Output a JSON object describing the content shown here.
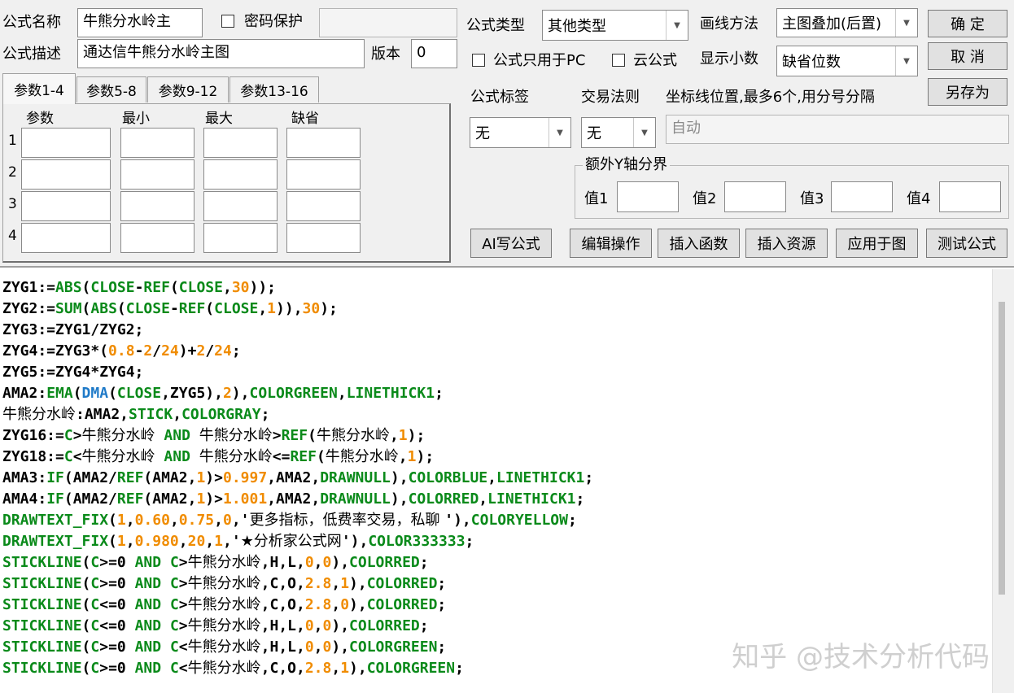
{
  "top": {
    "name_label": "公式名称",
    "name_value": "牛熊分水岭主",
    "password_label": "密码保护",
    "desc_label": "公式描述",
    "desc_value": "通达信牛熊分水岭主图",
    "version_label": "版本",
    "version_value": "0",
    "type_label": "公式类型",
    "type_value": "其他类型",
    "draw_label": "画线方法",
    "draw_value": "主图叠加(后置)",
    "pc_only_label": "公式只用于PC",
    "cloud_label": "云公式",
    "decimal_label": "显示小数",
    "decimal_value": "缺省位数",
    "ok_label": "确 定",
    "cancel_label": "取 消",
    "saveas_label": "另存为"
  },
  "params": {
    "tabs": [
      "参数1-4",
      "参数5-8",
      "参数9-12",
      "参数13-16"
    ],
    "headers": [
      "参数",
      "最小",
      "最大",
      "缺省"
    ],
    "rows": [
      "1",
      "2",
      "3",
      "4"
    ]
  },
  "right": {
    "tag_label": "公式标签",
    "tag_value": "无",
    "rule_label": "交易法则",
    "rule_value": "无",
    "axis_label": "坐标线位置,最多6个,用分号分隔",
    "axis_value": "自动",
    "yaxis_group": "额外Y轴分界",
    "y_labels": [
      "值1",
      "值2",
      "值3",
      "值4"
    ]
  },
  "actions": {
    "ai_label": "AI写公式",
    "edit_label": "编辑操作",
    "insert_func_label": "插入函数",
    "insert_res_label": "插入资源",
    "apply_label": "应用于图",
    "test_label": "测试公式"
  },
  "code_lines": [
    [
      [
        "t",
        "ZYG1:="
      ],
      [
        "k",
        "ABS"
      ],
      [
        "t",
        "("
      ],
      [
        "k",
        "CLOSE"
      ],
      [
        "t",
        "-"
      ],
      [
        "k",
        "REF"
      ],
      [
        "t",
        "("
      ],
      [
        "k",
        "CLOSE"
      ],
      [
        "t",
        ","
      ],
      [
        "n",
        "30"
      ],
      [
        "t",
        "));"
      ]
    ],
    [
      [
        "t",
        "ZYG2:="
      ],
      [
        "k",
        "SUM"
      ],
      [
        "t",
        "("
      ],
      [
        "k",
        "ABS"
      ],
      [
        "t",
        "("
      ],
      [
        "k",
        "CLOSE"
      ],
      [
        "t",
        "-"
      ],
      [
        "k",
        "REF"
      ],
      [
        "t",
        "("
      ],
      [
        "k",
        "CLOSE"
      ],
      [
        "t",
        ","
      ],
      [
        "n",
        "1"
      ],
      [
        "t",
        ")),"
      ],
      [
        "n",
        "30"
      ],
      [
        "t",
        ");"
      ]
    ],
    [
      [
        "t",
        "ZYG3:=ZYG1/ZYG2;"
      ]
    ],
    [
      [
        "t",
        "ZYG4:=ZYG3*("
      ],
      [
        "n",
        "0.8"
      ],
      [
        "t",
        "-"
      ],
      [
        "n",
        "2"
      ],
      [
        "t",
        "/"
      ],
      [
        "n",
        "24"
      ],
      [
        "t",
        ")+"
      ],
      [
        "n",
        "2"
      ],
      [
        "t",
        "/"
      ],
      [
        "n",
        "24"
      ],
      [
        "t",
        ";"
      ]
    ],
    [
      [
        "t",
        "ZYG5:=ZYG4*ZYG4;"
      ]
    ],
    [
      [
        "t",
        "AMA2:"
      ],
      [
        "k",
        "EMA"
      ],
      [
        "t",
        "("
      ],
      [
        "b",
        "DMA"
      ],
      [
        "t",
        "("
      ],
      [
        "k",
        "CLOSE"
      ],
      [
        "t",
        ",ZYG5),"
      ],
      [
        "n",
        "2"
      ],
      [
        "t",
        "),"
      ],
      [
        "k",
        "COLORGREEN"
      ],
      [
        "t",
        ","
      ],
      [
        "k",
        "LINETHICK1"
      ],
      [
        "t",
        ";"
      ]
    ],
    [
      [
        "c",
        "牛熊分水岭"
      ],
      [
        "t",
        ":AMA2,"
      ],
      [
        "k",
        "STICK"
      ],
      [
        "t",
        ","
      ],
      [
        "k",
        "COLORGRAY"
      ],
      [
        "t",
        ";"
      ]
    ],
    [
      [
        "t",
        "ZYG16:="
      ],
      [
        "k",
        "C"
      ],
      [
        "t",
        ">"
      ],
      [
        "c",
        "牛熊分水岭"
      ],
      [
        "t",
        " "
      ],
      [
        "k",
        "AND"
      ],
      [
        "t",
        " "
      ],
      [
        "c",
        "牛熊分水岭"
      ],
      [
        "t",
        ">"
      ],
      [
        "k",
        "REF"
      ],
      [
        "t",
        "("
      ],
      [
        "c",
        "牛熊分水岭"
      ],
      [
        "t",
        ","
      ],
      [
        "n",
        "1"
      ],
      [
        "t",
        ");"
      ]
    ],
    [
      [
        "t",
        "ZYG18:="
      ],
      [
        "k",
        "C"
      ],
      [
        "t",
        "<"
      ],
      [
        "c",
        "牛熊分水岭"
      ],
      [
        "t",
        " "
      ],
      [
        "k",
        "AND"
      ],
      [
        "t",
        " "
      ],
      [
        "c",
        "牛熊分水岭"
      ],
      [
        "t",
        "<="
      ],
      [
        "k",
        "REF"
      ],
      [
        "t",
        "("
      ],
      [
        "c",
        "牛熊分水岭"
      ],
      [
        "t",
        ","
      ],
      [
        "n",
        "1"
      ],
      [
        "t",
        ");"
      ]
    ],
    [
      [
        "t",
        "AMA3:"
      ],
      [
        "k",
        "IF"
      ],
      [
        "t",
        "(AMA2/"
      ],
      [
        "k",
        "REF"
      ],
      [
        "t",
        "(AMA2,"
      ],
      [
        "n",
        "1"
      ],
      [
        "t",
        ")>"
      ],
      [
        "n",
        "0.997"
      ],
      [
        "t",
        ",AMA2,"
      ],
      [
        "k",
        "DRAWNULL"
      ],
      [
        "t",
        "),"
      ],
      [
        "k",
        "COLORBLUE"
      ],
      [
        "t",
        ","
      ],
      [
        "k",
        "LINETHICK1"
      ],
      [
        "t",
        ";"
      ]
    ],
    [
      [
        "t",
        "AMA4:"
      ],
      [
        "k",
        "IF"
      ],
      [
        "t",
        "(AMA2/"
      ],
      [
        "k",
        "REF"
      ],
      [
        "t",
        "(AMA2,"
      ],
      [
        "n",
        "1"
      ],
      [
        "t",
        ")>"
      ],
      [
        "n",
        "1.001"
      ],
      [
        "t",
        ",AMA2,"
      ],
      [
        "k",
        "DRAWNULL"
      ],
      [
        "t",
        "),"
      ],
      [
        "k",
        "COLORRED"
      ],
      [
        "t",
        ","
      ],
      [
        "k",
        "LINETHICK1"
      ],
      [
        "t",
        ";"
      ]
    ],
    [
      [
        "k",
        "DRAWTEXT_FIX"
      ],
      [
        "t",
        "("
      ],
      [
        "n",
        "1"
      ],
      [
        "t",
        ","
      ],
      [
        "n",
        "0.60"
      ],
      [
        "t",
        ","
      ],
      [
        "n",
        "0.75"
      ],
      [
        "t",
        ","
      ],
      [
        "n",
        "0"
      ],
      [
        "t",
        ",'"
      ],
      [
        "c",
        "更多指标，低费率交易，私聊 "
      ],
      [
        "t",
        "'),"
      ],
      [
        "k",
        "COLORYELLOW"
      ],
      [
        "t",
        ";"
      ]
    ],
    [
      [
        "k",
        "DRAWTEXT_FIX"
      ],
      [
        "t",
        "("
      ],
      [
        "n",
        "1"
      ],
      [
        "t",
        ","
      ],
      [
        "n",
        "0.980"
      ],
      [
        "t",
        ","
      ],
      [
        "n",
        "20"
      ],
      [
        "t",
        ","
      ],
      [
        "n",
        "1"
      ],
      [
        "t",
        ",'"
      ],
      [
        "c",
        "★分析家公式网"
      ],
      [
        "t",
        "'),"
      ],
      [
        "k",
        "COLOR333333"
      ],
      [
        "t",
        ";"
      ]
    ],
    [
      [
        "k",
        "STICKLINE"
      ],
      [
        "t",
        "("
      ],
      [
        "k",
        "C"
      ],
      [
        "t",
        ">=0 "
      ],
      [
        "k",
        "AND"
      ],
      [
        "t",
        " "
      ],
      [
        "k",
        "C"
      ],
      [
        "t",
        ">"
      ],
      [
        "c",
        "牛熊分水岭"
      ],
      [
        "t",
        ",H,L,"
      ],
      [
        "n",
        "0"
      ],
      [
        "t",
        ","
      ],
      [
        "n",
        "0"
      ],
      [
        "t",
        "),"
      ],
      [
        "k",
        "COLORRED"
      ],
      [
        "t",
        ";"
      ]
    ],
    [
      [
        "k",
        "STICKLINE"
      ],
      [
        "t",
        "("
      ],
      [
        "k",
        "C"
      ],
      [
        "t",
        ">=0 "
      ],
      [
        "k",
        "AND"
      ],
      [
        "t",
        " "
      ],
      [
        "k",
        "C"
      ],
      [
        "t",
        ">"
      ],
      [
        "c",
        "牛熊分水岭"
      ],
      [
        "t",
        ",C,O,"
      ],
      [
        "n",
        "2.8"
      ],
      [
        "t",
        ","
      ],
      [
        "n",
        "1"
      ],
      [
        "t",
        "),"
      ],
      [
        "k",
        "COLORRED"
      ],
      [
        "t",
        ";"
      ]
    ],
    [
      [
        "k",
        "STICKLINE"
      ],
      [
        "t",
        "("
      ],
      [
        "k",
        "C"
      ],
      [
        "t",
        "<=0 "
      ],
      [
        "k",
        "AND"
      ],
      [
        "t",
        " "
      ],
      [
        "k",
        "C"
      ],
      [
        "t",
        ">"
      ],
      [
        "c",
        "牛熊分水岭"
      ],
      [
        "t",
        ",C,O,"
      ],
      [
        "n",
        "2.8"
      ],
      [
        "t",
        ","
      ],
      [
        "n",
        "0"
      ],
      [
        "t",
        "),"
      ],
      [
        "k",
        "COLORRED"
      ],
      [
        "t",
        ";"
      ]
    ],
    [
      [
        "k",
        "STICKLINE"
      ],
      [
        "t",
        "("
      ],
      [
        "k",
        "C"
      ],
      [
        "t",
        "<=0 "
      ],
      [
        "k",
        "AND"
      ],
      [
        "t",
        " "
      ],
      [
        "k",
        "C"
      ],
      [
        "t",
        ">"
      ],
      [
        "c",
        "牛熊分水岭"
      ],
      [
        "t",
        ",H,L,"
      ],
      [
        "n",
        "0"
      ],
      [
        "t",
        ","
      ],
      [
        "n",
        "0"
      ],
      [
        "t",
        "),"
      ],
      [
        "k",
        "COLORRED"
      ],
      [
        "t",
        ";"
      ]
    ],
    [
      [
        "k",
        "STICKLINE"
      ],
      [
        "t",
        "("
      ],
      [
        "k",
        "C"
      ],
      [
        "t",
        ">=0 "
      ],
      [
        "k",
        "AND"
      ],
      [
        "t",
        " "
      ],
      [
        "k",
        "C"
      ],
      [
        "t",
        "<"
      ],
      [
        "c",
        "牛熊分水岭"
      ],
      [
        "t",
        ",H,L,"
      ],
      [
        "n",
        "0"
      ],
      [
        "t",
        ","
      ],
      [
        "n",
        "0"
      ],
      [
        "t",
        "),"
      ],
      [
        "k",
        "COLORGREEN"
      ],
      [
        "t",
        ";"
      ]
    ],
    [
      [
        "k",
        "STICKLINE"
      ],
      [
        "t",
        "("
      ],
      [
        "k",
        "C"
      ],
      [
        "t",
        ">=0 "
      ],
      [
        "k",
        "AND"
      ],
      [
        "t",
        " "
      ],
      [
        "k",
        "C"
      ],
      [
        "t",
        "<"
      ],
      [
        "c",
        "牛熊分水岭"
      ],
      [
        "t",
        ",C,O,"
      ],
      [
        "n",
        "2.8"
      ],
      [
        "t",
        ","
      ],
      [
        "n",
        "1"
      ],
      [
        "t",
        "),"
      ],
      [
        "k",
        "COLORGREEN"
      ],
      [
        "t",
        ";"
      ]
    ]
  ],
  "watermark": "知乎 @技术分析代码",
  "colors": {
    "keyword": "#0a8a1a",
    "number": "#f08c00",
    "builtin_blue": "#1f7ac8"
  },
  "icons": [
    "dropdown-arrow-icon",
    "checkbox-icon"
  ]
}
